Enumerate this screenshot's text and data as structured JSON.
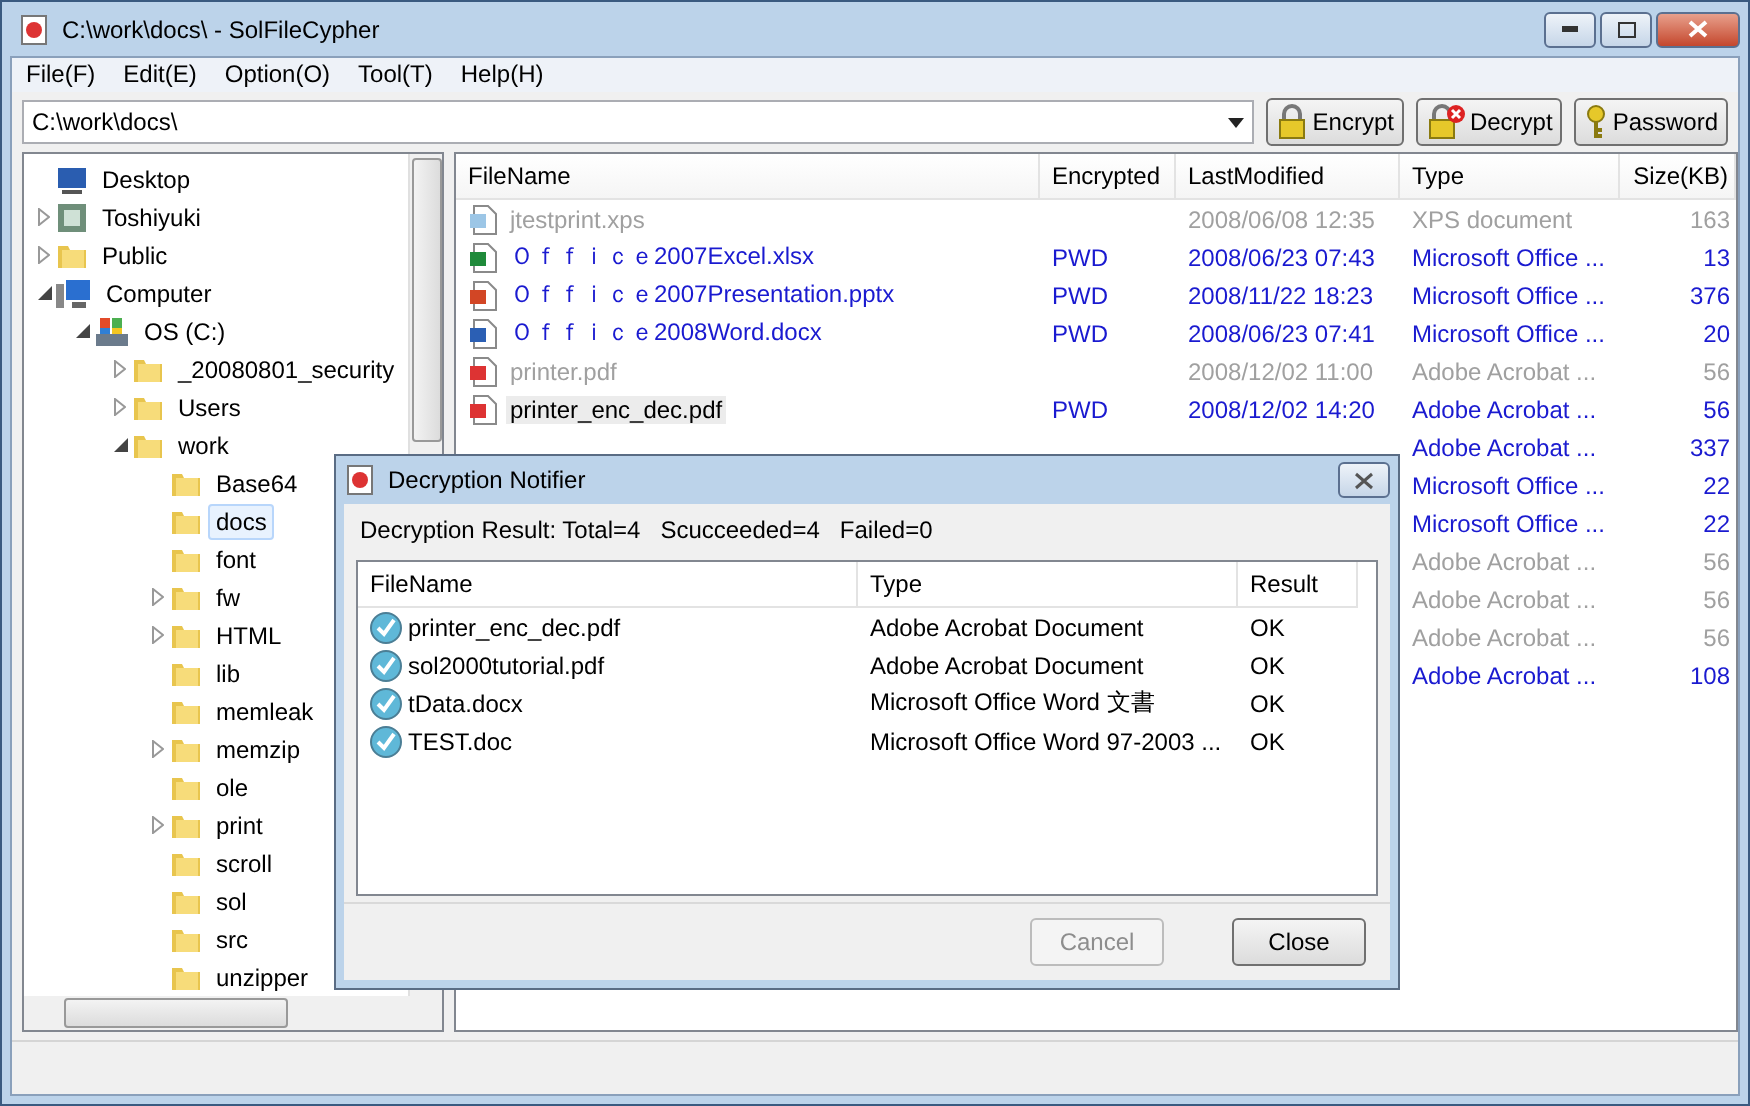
{
  "window": {
    "title": "C:\\work\\docs\\ - SolFileCypher"
  },
  "menu": [
    "File(F)",
    "Edit(E)",
    "Option(O)",
    "Tool(T)",
    "Help(H)"
  ],
  "address": {
    "value": "C:\\work\\docs\\"
  },
  "toolbar": [
    {
      "label": "Encrypt",
      "kind": "encrypt"
    },
    {
      "label": "Decrypt",
      "kind": "decrypt"
    },
    {
      "label": "Password",
      "kind": "password"
    }
  ],
  "tree": [
    {
      "label": "Desktop",
      "kind": "desktop",
      "expandable": false,
      "selected": false
    },
    {
      "label": "Toshiyuki",
      "kind": "user",
      "expandable": true,
      "expanded": false,
      "selected": false
    },
    {
      "label": "Public",
      "kind": "folder",
      "expandable": true,
      "expanded": false,
      "selected": false
    },
    {
      "label": "Computer",
      "kind": "computer",
      "expandable": true,
      "expanded": true,
      "selected": false,
      "children": [
        {
          "label": "OS (C:)",
          "kind": "drive",
          "expandable": true,
          "expanded": true,
          "selected": false,
          "children": [
            {
              "label": "_20080801_security",
              "kind": "folder",
              "expandable": true,
              "expanded": false,
              "selected": false
            },
            {
              "label": "Users",
              "kind": "folder",
              "expandable": true,
              "expanded": false,
              "selected": false
            },
            {
              "label": "work",
              "kind": "folder",
              "expandable": true,
              "expanded": true,
              "selected": false,
              "children": [
                {
                  "label": "Base64",
                  "kind": "folder",
                  "expandable": false,
                  "selected": false
                },
                {
                  "label": "docs",
                  "kind": "folder",
                  "expandable": false,
                  "selected": true
                },
                {
                  "label": "font",
                  "kind": "folder",
                  "expandable": false,
                  "selected": false
                },
                {
                  "label": "fw",
                  "kind": "folder",
                  "expandable": true,
                  "expanded": false,
                  "selected": false
                },
                {
                  "label": "HTML",
                  "kind": "folder",
                  "expandable": true,
                  "expanded": false,
                  "selected": false
                },
                {
                  "label": "lib",
                  "kind": "folder",
                  "expandable": false,
                  "selected": false
                },
                {
                  "label": "memleak",
                  "kind": "folder",
                  "expandable": false,
                  "selected": false
                },
                {
                  "label": "memzip",
                  "kind": "folder",
                  "expandable": true,
                  "expanded": false,
                  "selected": false
                },
                {
                  "label": "ole",
                  "kind": "folder",
                  "expandable": false,
                  "selected": false
                },
                {
                  "label": "print",
                  "kind": "folder",
                  "expandable": true,
                  "expanded": false,
                  "selected": false
                },
                {
                  "label": "scroll",
                  "kind": "folder",
                  "expandable": false,
                  "selected": false
                },
                {
                  "label": "sol",
                  "kind": "folder",
                  "expandable": false,
                  "selected": false
                },
                {
                  "label": "src",
                  "kind": "folder",
                  "expandable": false,
                  "selected": false
                },
                {
                  "label": "unzipper",
                  "kind": "folder",
                  "expandable": false,
                  "selected": false
                }
              ]
            }
          ]
        }
      ]
    }
  ],
  "file_list": {
    "columns": [
      "FileName",
      "Encrypted",
      "LastModified",
      "Type",
      "Size(KB)"
    ],
    "rows": [
      {
        "kind": "xps",
        "name": "jtestprint.xps",
        "encrypted": false,
        "highlighted": false,
        "modified": "2008/06/08 12:35",
        "type": "XPS document",
        "size": "163"
      },
      {
        "kind": "excel",
        "name": "Ｏｆｆｉｃｅ2007Excel.xlsx",
        "encrypted": true,
        "highlighted": false,
        "flag": "PWD",
        "modified": "2008/06/23 07:43",
        "type": "Microsoft Office ...",
        "size": "13"
      },
      {
        "kind": "powerpoint",
        "name": "Ｏｆｆｉｃｅ2007Presentation.pptx",
        "encrypted": true,
        "highlighted": false,
        "flag": "PWD",
        "modified": "2008/11/22 18:23",
        "type": "Microsoft Office ...",
        "size": "376"
      },
      {
        "kind": "word",
        "name": "Ｏｆｆｉｃｅ2008Word.docx",
        "encrypted": true,
        "highlighted": false,
        "flag": "PWD",
        "modified": "2008/06/23 07:41",
        "type": "Microsoft Office ...",
        "size": "20"
      },
      {
        "kind": "pdf",
        "name": "printer.pdf",
        "encrypted": false,
        "highlighted": false,
        "modified": "2008/12/02 11:00",
        "type": "Adobe Acrobat ...",
        "size": "56"
      },
      {
        "kind": "pdf",
        "name": "printer_enc_dec.pdf",
        "encrypted": true,
        "highlighted": true,
        "flag": "PWD",
        "modified": "2008/12/02 14:20",
        "type": "Adobe Acrobat ...",
        "size": "56"
      },
      {
        "encrypted": true,
        "type": "Adobe Acrobat ...",
        "size": "337"
      },
      {
        "encrypted": true,
        "type": "Microsoft Office ...",
        "size": "22"
      },
      {
        "encrypted": true,
        "type": "Microsoft Office ...",
        "size": "22"
      },
      {
        "encrypted": false,
        "type": "Adobe Acrobat ...",
        "size": "56"
      },
      {
        "encrypted": false,
        "type": "Adobe Acrobat ...",
        "size": "56"
      },
      {
        "encrypted": false,
        "type": "Adobe Acrobat ...",
        "size": "56"
      },
      {
        "encrypted": true,
        "type": "Adobe Acrobat ...",
        "size": "108"
      }
    ]
  },
  "dialog": {
    "title": "Decryption Notifier",
    "summary": "Decryption Result: Total=4   Scucceeded=4   Failed=0",
    "columns": [
      "FileName",
      "Type",
      "Result"
    ],
    "rows": [
      {
        "name": "printer_enc_dec.pdf",
        "type": "Adobe Acrobat Document",
        "result": "OK"
      },
      {
        "name": "sol2000tutorial.pdf",
        "type": "Adobe Acrobat Document",
        "result": "OK"
      },
      {
        "name": "tData.docx",
        "type": "Microsoft Office Word 文書",
        "result": "OK"
      },
      {
        "name": "TEST.doc",
        "type": "Microsoft Office Word 97-2003 ...",
        "result": "OK"
      }
    ],
    "buttons": [
      {
        "label": "Cancel",
        "disabled": true
      },
      {
        "label": "Close",
        "disabled": false
      }
    ]
  }
}
